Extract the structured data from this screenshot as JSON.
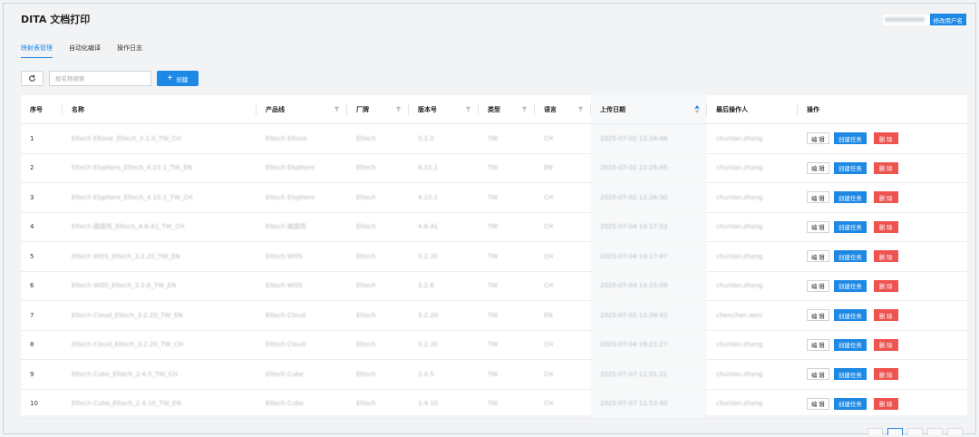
{
  "app": {
    "title": "DITA 文档打印"
  },
  "user": {
    "rename_label": "修改用户名"
  },
  "tabs": [
    {
      "label": "映射表管理",
      "active": true
    },
    {
      "label": "自动化编译",
      "active": false
    },
    {
      "label": "操作日志",
      "active": false
    }
  ],
  "toolbar": {
    "search_placeholder": "按名称搜索",
    "create_label": "创建"
  },
  "table": {
    "headers": [
      "序号",
      "名称",
      "产品线",
      "厂牌",
      "版本号",
      "类型",
      "语言",
      "上传日期",
      "最后操作人",
      "操作"
    ],
    "actions": {
      "edit": "编 辑",
      "create_task": "创建任务",
      "delete": "删 除"
    },
    "rows": [
      {
        "no": "1",
        "name": "Eltech Eltone_Eltech_3.2.0_TW_CH",
        "line": "Eltech Eltone",
        "brand": "Eltech",
        "version": "3.2.0",
        "type": "TW",
        "lang": "CH",
        "date": "2025-07-02 12:24:48",
        "user": "chunlan.zhang"
      },
      {
        "no": "2",
        "name": "Eltech Elsphere_Eltech_4.10.1_TW_EN",
        "line": "Eltech Elsphere",
        "brand": "Eltech",
        "version": "4.10.1",
        "type": "TW",
        "lang": "EN",
        "date": "2025-07-02 12:25:45",
        "user": "chunlan.zhang"
      },
      {
        "no": "3",
        "name": "Eltech Elsphere_Eltech_4.10.1_TW_CH",
        "line": "Eltech Elsphere",
        "brand": "Eltech",
        "version": "4.10.1",
        "type": "TW",
        "lang": "CH",
        "date": "2025-07-02 12:26:30",
        "user": "chunlan.zhang"
      },
      {
        "no": "4",
        "name": "Eltech 磁盘阵_Eltech_4.6.41_TW_CH",
        "line": "Eltech 磁盘阵",
        "brand": "Eltech",
        "version": "4.6.41",
        "type": "TW",
        "lang": "CH",
        "date": "2025-07-04 14:17:53",
        "user": "chunlan.zhang"
      },
      {
        "no": "5",
        "name": "Eltech WOS_Eltech_3.2.20_TW_EN",
        "line": "Eltech WOS",
        "brand": "Eltech",
        "version": "3.2.20",
        "type": "TW",
        "lang": "CH",
        "date": "2025-07-04 14:17:47",
        "user": "chunlan.zhang"
      },
      {
        "no": "6",
        "name": "Eltech WOS_Eltech_3.2.6_TW_EN",
        "line": "Eltech WOS",
        "brand": "Eltech",
        "version": "3.2.6",
        "type": "TW",
        "lang": "CH",
        "date": "2025-07-04 14:15:59",
        "user": "chunlan.zhang"
      },
      {
        "no": "7",
        "name": "Eltech Cloud_Eltech_3.2.20_TW_EN",
        "line": "Eltech Cloud",
        "brand": "Eltech",
        "version": "3.2.20",
        "type": "TW",
        "lang": "EN",
        "date": "2025-07-05 13:39:42",
        "user": "chenchen.wen"
      },
      {
        "no": "8",
        "name": "Eltech Cloud_Eltech_3.2.20_TW_CH",
        "line": "Eltech Cloud",
        "brand": "Eltech",
        "version": "3.2.20",
        "type": "TW",
        "lang": "CH",
        "date": "2025-07-04 16:21:27",
        "user": "chunlan.zhang"
      },
      {
        "no": "9",
        "name": "Eltech Cube_Eltech_2.4.5_TW_CH",
        "line": "Eltech Cube",
        "brand": "Eltech",
        "version": "2.4.5",
        "type": "TW",
        "lang": "CH",
        "date": "2025-07-07 11:51:21",
        "user": "chunlan.zhang"
      },
      {
        "no": "10",
        "name": "Eltech Cube_Eltech_2.4.10_TW_EN",
        "line": "Eltech Cube",
        "brand": "Eltech",
        "version": "2.4.10",
        "type": "TW",
        "lang": "CH",
        "date": "2025-07-07 11:53:40",
        "user": "chunlan.zhang"
      }
    ]
  },
  "colors": {
    "accent": "#1e88e5",
    "danger": "#ef5350"
  }
}
